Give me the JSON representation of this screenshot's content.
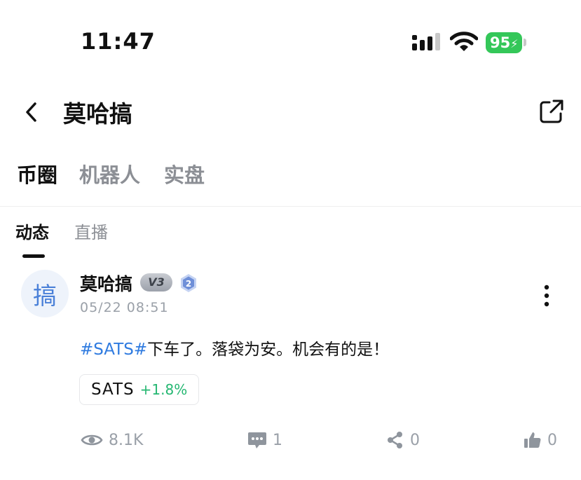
{
  "status_bar": {
    "time": "11:47",
    "battery": "95"
  },
  "header": {
    "title": "莫哈搞"
  },
  "main_tabs": [
    {
      "label": "币圈",
      "active": true
    },
    {
      "label": "机器人",
      "active": false
    },
    {
      "label": "实盘",
      "active": false
    }
  ],
  "sub_tabs": [
    {
      "label": "动态",
      "active": true
    },
    {
      "label": "直播",
      "active": false
    }
  ],
  "post": {
    "avatar_char": "搞",
    "username": "莫哈搞",
    "vip_badge": "V3",
    "level_badge": "2",
    "date": "05/22 08:51",
    "hashtag": "#SATS#",
    "text": "下车了。落袋为安。机会有的是！",
    "coin": {
      "symbol": "SATS",
      "change": "+1.8%"
    },
    "stats": {
      "views": "8.1K",
      "comments": "1",
      "shares": "0",
      "likes": "0"
    }
  },
  "colors": {
    "accent_blue": "#2f7be0",
    "positive_green": "#25b772",
    "battery_green": "#34c759"
  }
}
